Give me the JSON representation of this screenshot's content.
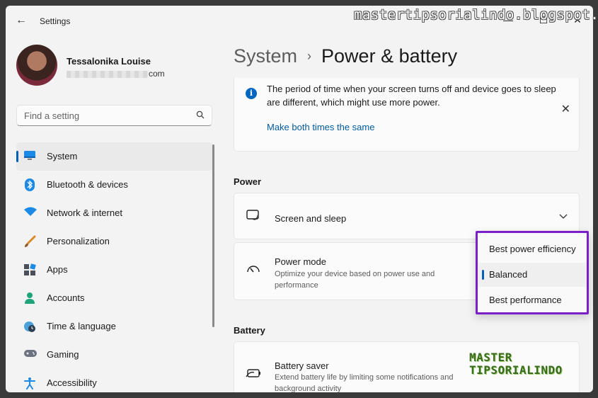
{
  "window": {
    "app_title": "Settings",
    "back_glyph": "←",
    "minimize_glyph": "—",
    "maximize_glyph": "☐",
    "close_glyph": "✕"
  },
  "watermark": "mastertipsorialindo.blogspot.com",
  "profile": {
    "name": "Tessalonika Louise",
    "email_suffix": "com"
  },
  "search": {
    "placeholder": "Find a setting",
    "icon": "search-icon"
  },
  "sidebar": {
    "items": [
      {
        "label": "System",
        "icon": "monitor-icon",
        "active": true
      },
      {
        "label": "Bluetooth & devices",
        "icon": "bluetooth-icon"
      },
      {
        "label": "Network & internet",
        "icon": "wifi-icon"
      },
      {
        "label": "Personalization",
        "icon": "brush-icon"
      },
      {
        "label": "Apps",
        "icon": "apps-icon"
      },
      {
        "label": "Accounts",
        "icon": "person-icon"
      },
      {
        "label": "Time & language",
        "icon": "globe-clock-icon"
      },
      {
        "label": "Gaming",
        "icon": "gamepad-icon"
      },
      {
        "label": "Accessibility",
        "icon": "accessibility-icon"
      }
    ]
  },
  "breadcrumb": {
    "parent": "System",
    "separator": "›",
    "current": "Power & battery"
  },
  "info": {
    "text": "The period of time when your screen turns off and device goes to sleep are different, which might use more power.",
    "link": "Make both times the same"
  },
  "power": {
    "section_title": "Power",
    "screen_sleep": {
      "title": "Screen and sleep"
    },
    "power_mode": {
      "title": "Power mode",
      "description": "Optimize your device based on power use and performance",
      "options": [
        "Best power efficiency",
        "Balanced",
        "Best performance"
      ],
      "selected": "Balanced"
    }
  },
  "battery": {
    "section_title": "Battery",
    "saver": {
      "title": "Battery saver",
      "description": "Extend battery life by limiting some notifications and background activity"
    }
  },
  "logo": {
    "line1": "MASTER",
    "line2": "TIPSORIALINDO"
  },
  "colors": {
    "accent": "#005fb8",
    "link": "#005a9e",
    "highlight_border": "#7a1fc7"
  }
}
